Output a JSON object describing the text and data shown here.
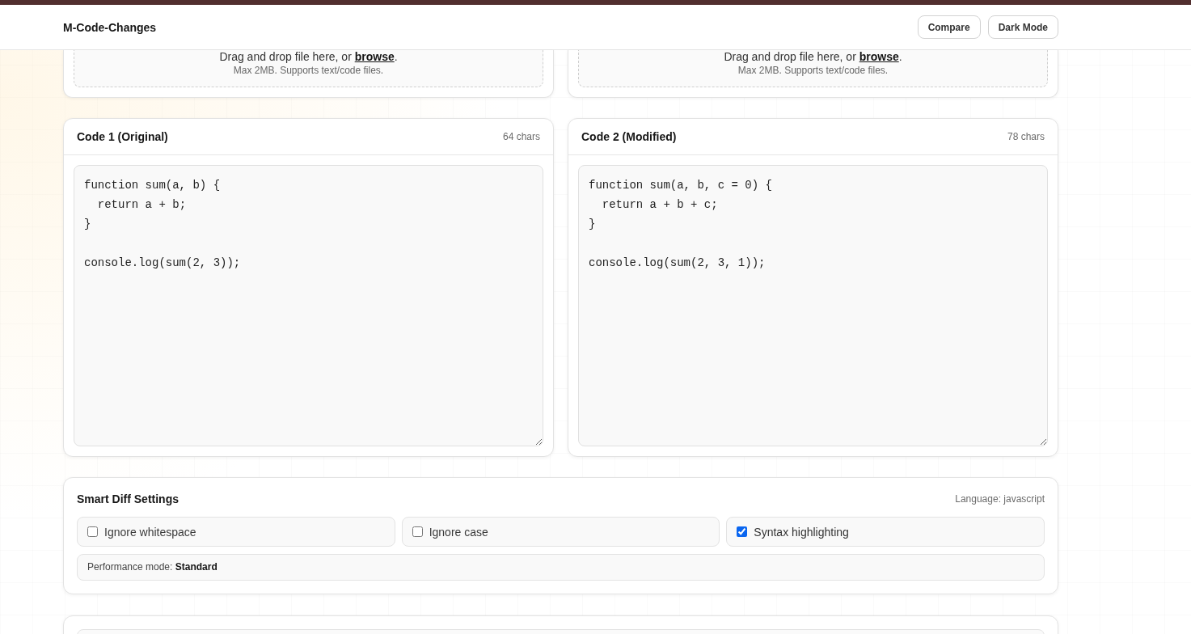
{
  "header": {
    "title": "M-Code-Changes",
    "buttons": [
      {
        "label": "Compare"
      },
      {
        "label": "Dark Mode"
      }
    ]
  },
  "upload_panels": [
    {
      "prompt": "Drag and drop file here, or",
      "link": "browse",
      "after": ".",
      "hint": "Max 2MB. Supports text/code files."
    },
    {
      "prompt": "Drag and drop file here, or",
      "link": "browse",
      "after": ".",
      "hint": "Max 2MB. Supports text/code files."
    }
  ],
  "editors": [
    {
      "title": "Code 1 (Original)",
      "count": "64 chars",
      "code": "function sum(a, b) {\n  return a + b;\n}\n\nconsole.log(sum(2, 3));"
    },
    {
      "title": "Code 2 (Modified)",
      "count": "78 chars",
      "code": "function sum(a, b, c = 0) {\n  return a + b + c;\n}\n\nconsole.log(sum(2, 3, 1));"
    }
  ],
  "settings": {
    "title": "Smart Diff Settings",
    "language": "Language: javascript",
    "options": [
      {
        "label": "Ignore whitespace",
        "checked": false
      },
      {
        "label": "Ignore case",
        "checked": false
      },
      {
        "label": "Syntax highlighting",
        "checked": true
      }
    ],
    "performance": "Performance mode: **Standard**"
  }
}
